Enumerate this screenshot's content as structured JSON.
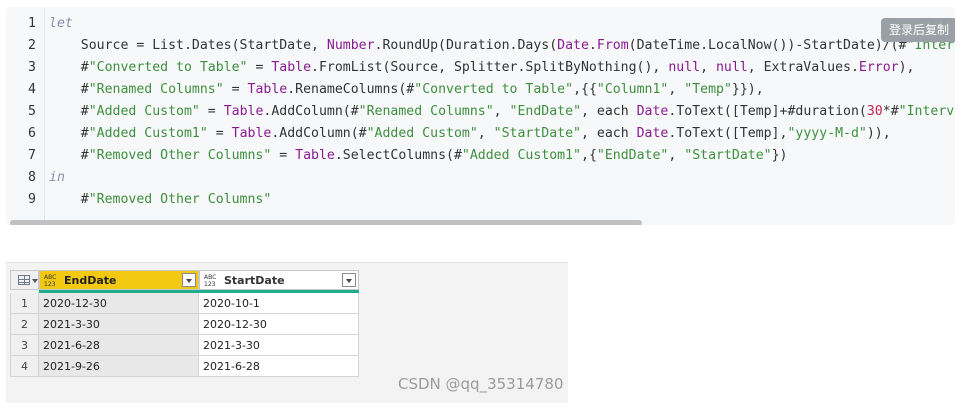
{
  "code": {
    "copy_button_label": "登录后复制",
    "lines": [
      {
        "num": "1",
        "tokens": [
          {
            "t": "let",
            "c": "kw"
          }
        ]
      },
      {
        "num": "2",
        "tokens": [
          {
            "t": "    Source = List.Dates(StartDate, ",
            "c": "pl"
          },
          {
            "t": "Number",
            "c": "fn"
          },
          {
            "t": ".RoundUp(Duration.Days(",
            "c": "pl"
          },
          {
            "t": "Date",
            "c": "fn"
          },
          {
            "t": ".",
            "c": "pl"
          },
          {
            "t": "From",
            "c": "fn"
          },
          {
            "t": "(DateTime.LocalNow())-StartDate)/(#",
            "c": "pl"
          },
          {
            "t": "\"Interval",
            "c": "str"
          }
        ]
      },
      {
        "num": "3",
        "tokens": [
          {
            "t": "    #",
            "c": "pl"
          },
          {
            "t": "\"Converted to Table\"",
            "c": "str"
          },
          {
            "t": " = ",
            "c": "pl"
          },
          {
            "t": "Table",
            "c": "fn"
          },
          {
            "t": ".FromList(Source, Splitter.SplitByNothing(), ",
            "c": "pl"
          },
          {
            "t": "null",
            "c": "fn"
          },
          {
            "t": ", ",
            "c": "pl"
          },
          {
            "t": "null",
            "c": "fn"
          },
          {
            "t": ", ExtraValues.",
            "c": "pl"
          },
          {
            "t": "Error",
            "c": "fn"
          },
          {
            "t": "),",
            "c": "pl"
          }
        ]
      },
      {
        "num": "4",
        "tokens": [
          {
            "t": "    #",
            "c": "pl"
          },
          {
            "t": "\"Renamed Columns\"",
            "c": "str"
          },
          {
            "t": " = ",
            "c": "pl"
          },
          {
            "t": "Table",
            "c": "fn"
          },
          {
            "t": ".RenameColumns(#",
            "c": "pl"
          },
          {
            "t": "\"Converted to Table\"",
            "c": "str"
          },
          {
            "t": ",{{",
            "c": "pl"
          },
          {
            "t": "\"Column1\"",
            "c": "str"
          },
          {
            "t": ", ",
            "c": "pl"
          },
          {
            "t": "\"Temp\"",
            "c": "str"
          },
          {
            "t": "}}),",
            "c": "pl"
          }
        ]
      },
      {
        "num": "5",
        "tokens": [
          {
            "t": "    #",
            "c": "pl"
          },
          {
            "t": "\"Added Custom\"",
            "c": "str"
          },
          {
            "t": " = ",
            "c": "pl"
          },
          {
            "t": "Table",
            "c": "fn"
          },
          {
            "t": ".AddColumn(#",
            "c": "pl"
          },
          {
            "t": "\"Renamed Columns\"",
            "c": "str"
          },
          {
            "t": ", ",
            "c": "pl"
          },
          {
            "t": "\"EndDate\"",
            "c": "str"
          },
          {
            "t": ", each ",
            "c": "pl"
          },
          {
            "t": "Date",
            "c": "fn"
          },
          {
            "t": ".ToText([Temp]+#duration(",
            "c": "pl"
          },
          {
            "t": "30",
            "c": "num"
          },
          {
            "t": "*#",
            "c": "pl"
          },
          {
            "t": "\"Interval (",
            "c": "str"
          }
        ]
      },
      {
        "num": "6",
        "tokens": [
          {
            "t": "    #",
            "c": "pl"
          },
          {
            "t": "\"Added Custom1\"",
            "c": "str"
          },
          {
            "t": " = ",
            "c": "pl"
          },
          {
            "t": "Table",
            "c": "fn"
          },
          {
            "t": ".AddColumn(#",
            "c": "pl"
          },
          {
            "t": "\"Added Custom\"",
            "c": "str"
          },
          {
            "t": ", ",
            "c": "pl"
          },
          {
            "t": "\"StartDate\"",
            "c": "str"
          },
          {
            "t": ", each ",
            "c": "pl"
          },
          {
            "t": "Date",
            "c": "fn"
          },
          {
            "t": ".ToText([Temp],",
            "c": "pl"
          },
          {
            "t": "\"yyyy-M-d\"",
            "c": "str"
          },
          {
            "t": ")),",
            "c": "pl"
          }
        ]
      },
      {
        "num": "7",
        "tokens": [
          {
            "t": "    #",
            "c": "pl"
          },
          {
            "t": "\"Removed Other Columns\"",
            "c": "str"
          },
          {
            "t": " = ",
            "c": "pl"
          },
          {
            "t": "Table",
            "c": "fn"
          },
          {
            "t": ".SelectColumns(#",
            "c": "pl"
          },
          {
            "t": "\"Added Custom1\"",
            "c": "str"
          },
          {
            "t": ",{",
            "c": "pl"
          },
          {
            "t": "\"EndDate\"",
            "c": "str"
          },
          {
            "t": ", ",
            "c": "pl"
          },
          {
            "t": "\"StartDate\"",
            "c": "str"
          },
          {
            "t": "})",
            "c": "pl"
          }
        ]
      },
      {
        "num": "8",
        "tokens": [
          {
            "t": "in",
            "c": "kw"
          }
        ]
      },
      {
        "num": "9",
        "tokens": [
          {
            "t": "    #",
            "c": "pl"
          },
          {
            "t": "\"Removed Other Columns\"",
            "c": "str"
          }
        ]
      }
    ]
  },
  "table": {
    "columns": [
      {
        "name": "EndDate",
        "type_icon": "ABC 123",
        "selected": true
      },
      {
        "name": "StartDate",
        "type_icon": "ABC 123",
        "selected": false
      }
    ],
    "rows": [
      {
        "num": "1",
        "cells": [
          "2020-12-30",
          "2020-10-1"
        ]
      },
      {
        "num": "2",
        "cells": [
          "2021-3-30",
          "2020-12-30"
        ]
      },
      {
        "num": "3",
        "cells": [
          "2021-6-28",
          "2021-3-30"
        ]
      },
      {
        "num": "4",
        "cells": [
          "2021-9-26",
          "2021-6-28"
        ]
      }
    ],
    "column_quality_color": "#1fae8c",
    "selected_column_color": "#f2c811"
  },
  "watermark": "CSDN @qq_35314780"
}
